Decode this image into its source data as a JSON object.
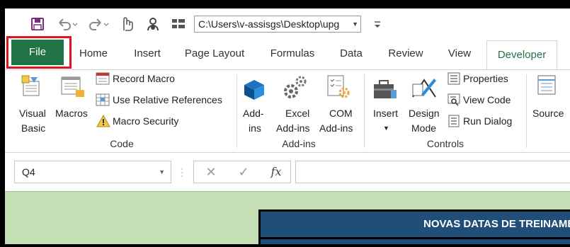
{
  "qat": {
    "path": "C:\\Users\\v-assisgs\\Desktop\\upg",
    "icons": [
      "save-icon",
      "undo-icon",
      "redo-icon",
      "touch-mode-icon",
      "share-icon",
      "grid-icon",
      "customize-icon"
    ]
  },
  "tabs": {
    "file": "File",
    "home": "Home",
    "insert": "Insert",
    "page_layout": "Page Layout",
    "formulas": "Formulas",
    "data": "Data",
    "review": "Review",
    "view": "View",
    "developer": "Developer"
  },
  "ribbon": {
    "code": {
      "visual_basic_1": "Visual",
      "visual_basic_2": "Basic",
      "macros": "Macros",
      "record_macro": "Record Macro",
      "use_relative": "Use Relative References",
      "macro_security": "Macro Security",
      "label": "Code"
    },
    "addins": {
      "addins_1": "Add-",
      "addins_2": "ins",
      "excel_1": "Excel",
      "excel_2": "Add-ins",
      "com_1": "COM",
      "com_2": "Add-ins",
      "label": "Add-ins"
    },
    "controls": {
      "insert": "Insert",
      "design_1": "Design",
      "design_2": "Mode",
      "properties": "Properties",
      "view_code": "View Code",
      "run_dialog": "Run Dialog",
      "label": "Controls"
    },
    "xml": {
      "source": "Source"
    }
  },
  "formula_bar": {
    "name_box": "Q4",
    "cancel": "✕",
    "enter": "✓",
    "fx": "fx"
  },
  "sheet": {
    "banner": "NOVAS DATAS DE TREINAMENTO"
  },
  "colors": {
    "file_tab": "#217346",
    "highlight": "#e0141e",
    "sheet_bg": "#c5dfb4",
    "banner": "#1f4e79"
  }
}
